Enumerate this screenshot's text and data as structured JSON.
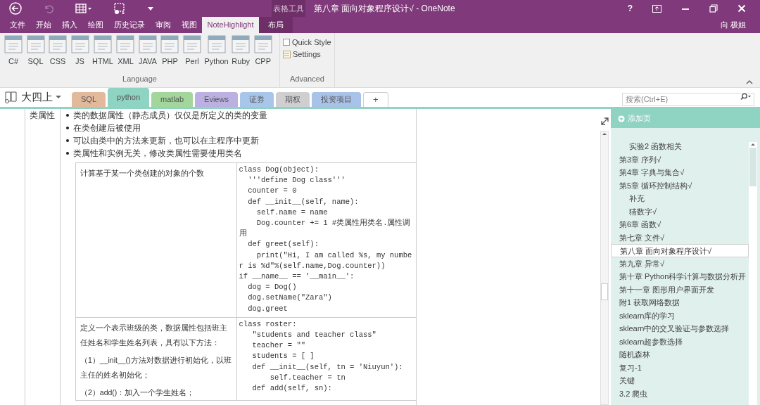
{
  "window": {
    "title": "第八章 面向对象程序设计√ - OneNote",
    "context_label": "表格工具",
    "user": "向 极姐",
    "help": "?"
  },
  "quick_access": [
    {
      "kind": "back"
    },
    {
      "kind": "undo",
      "disabled": true
    },
    {
      "kind": "table"
    },
    {
      "kind": "clip"
    },
    {
      "kind": "customize"
    }
  ],
  "ribbon_tabs": [
    {
      "label": "文件",
      "selected": false,
      "contextual": false
    },
    {
      "label": "开始",
      "selected": false,
      "contextual": false
    },
    {
      "label": "插入",
      "selected": false,
      "contextual": false
    },
    {
      "label": "绘图",
      "selected": false,
      "contextual": false
    },
    {
      "label": "历史记录",
      "selected": false,
      "contextual": false
    },
    {
      "label": "审阅",
      "selected": false,
      "contextual": false
    },
    {
      "label": "视图",
      "selected": false,
      "contextual": false
    },
    {
      "label": "NoteHighlight",
      "selected": true,
      "contextual": false
    },
    {
      "label": "布局",
      "selected": false,
      "contextual": true
    }
  ],
  "ribbon_groups": [
    {
      "name": "Language",
      "buttons": [
        "C#",
        "SQL",
        "CSS",
        "JS",
        "HTML",
        "XML",
        "JAVA",
        "PHP",
        "Perl",
        "Python",
        "Ruby",
        "CPP"
      ]
    },
    {
      "name": "Advanced",
      "items": [
        {
          "kind": "checkbox",
          "label": "Quick Style",
          "checked": false
        },
        {
          "kind": "settings",
          "label": "Settings"
        }
      ]
    }
  ],
  "notebook": {
    "name": "大四上"
  },
  "sections": [
    {
      "label": "SQL",
      "color": "#e2b99b",
      "selected": false
    },
    {
      "label": "python",
      "color": "#8fd3c3",
      "selected": true
    },
    {
      "label": "matlab",
      "color": "#a3d69b",
      "selected": false
    },
    {
      "label": "Eviews",
      "color": "#bcb0e2",
      "selected": false
    },
    {
      "label": "证券",
      "color": "#a8c5ea",
      "selected": false
    },
    {
      "label": "期权",
      "color": "#cfcfd2",
      "selected": false
    },
    {
      "label": "投资项目",
      "color": "#a9c2e8",
      "selected": false
    },
    {
      "label": "+",
      "color": "#ffffff",
      "selected": false
    }
  ],
  "search": {
    "placeholder": "搜索(Ctrl+E)"
  },
  "page": {
    "outline": {
      "term": "类属性",
      "bullets": [
        "类的数据属性（静态成员）仅仅是所定义的类的变量",
        "在类创建后被使用",
        "可以由类中的方法来更新，也可以在主程序中更新",
        "类属性和实例无关，修改类属性需要使用类名"
      ],
      "examples": [
        {
          "description": [
            "计算基于某一个类创建的对象的个数"
          ],
          "code": [
            "class Dog(object):",
            "  '''define Dog class'''",
            "  counter = 0",
            "  def __init__(self, name):",
            "    self.name = name",
            "    Dog.counter += 1 #类属性用类名.属性调用",
            "  def greet(self):",
            "    print(\"Hi, I am called %s, my number is %d\"%(self.name,Dog.counter))",
            "if __name__ == '__main__':",
            "  dog = Dog()",
            "  dog.setName(\"Zara\")",
            "  dog.greet"
          ]
        },
        {
          "description": [
            "定义一个表示班级的类，数据属性包括班主任姓名和学生姓名列表，具有以下方法：",
            "（1）__init__()方法对数据进行初始化，以班主任的姓名初始化；",
            "（2）add()：加入一个学生姓名；"
          ],
          "code": [
            "class roster:",
            "   \"students and teacher class\"",
            "   teacher = \"\"",
            "   students = [ ]",
            "   def __init__(self, tn = 'Niuyun'):",
            "       self.teacher = tn",
            "   def add(self, sn):"
          ]
        }
      ]
    }
  },
  "pages": {
    "add_page": "添加页",
    "items": [
      {
        "label": "实验2  函数相关",
        "kind": "subpage",
        "selected": false
      },
      {
        "label": "第3章 序列√",
        "kind": "page",
        "selected": false
      },
      {
        "label": "第4章 字典与集合√",
        "kind": "page",
        "selected": false
      },
      {
        "label": "第5章 循环控制结构√",
        "kind": "page",
        "selected": false,
        "children": [
          {
            "label": "补充",
            "selected": false
          },
          {
            "label": "猜数字√",
            "selected": false
          }
        ]
      },
      {
        "label": "第6章 函数√",
        "kind": "page",
        "selected": false
      },
      {
        "label": "第七章 文件√",
        "kind": "page",
        "selected": false
      },
      {
        "label": "第八章 面向对象程序设计√",
        "kind": "page",
        "selected": true
      },
      {
        "label": "第九章 异常√",
        "kind": "page",
        "selected": false
      },
      {
        "label": "第十章 Python科学计算与数据分析开",
        "kind": "page",
        "selected": false
      },
      {
        "label": "第十一章 图形用户界面开发",
        "kind": "page",
        "selected": false
      },
      {
        "label": "附1 获取网络数据",
        "kind": "page",
        "selected": false
      },
      {
        "label": "sklearn库的学习",
        "kind": "page",
        "selected": false
      },
      {
        "label": "sklearn中的交叉验证与参数选择",
        "kind": "page",
        "selected": false
      },
      {
        "label": "sklearn超参数选择",
        "kind": "page",
        "selected": false
      },
      {
        "label": "随机森林",
        "kind": "page",
        "selected": false
      },
      {
        "label": "复习-1",
        "kind": "page",
        "selected": false
      },
      {
        "label": "关键",
        "kind": "page",
        "selected": false
      },
      {
        "label": "3.2 爬虫",
        "kind": "page",
        "selected": false
      }
    ]
  }
}
